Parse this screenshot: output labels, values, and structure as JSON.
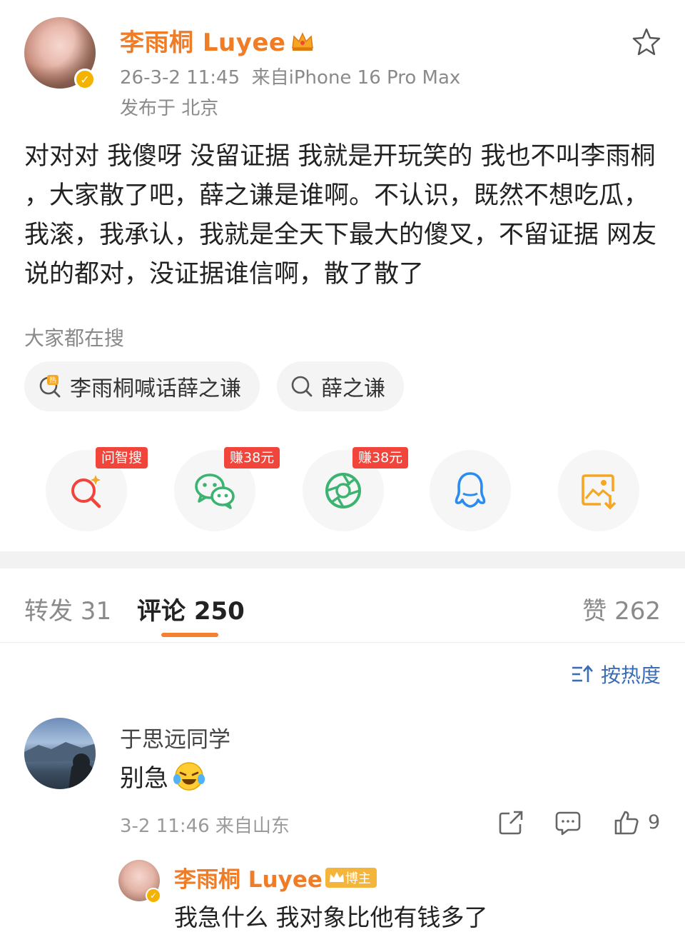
{
  "post": {
    "author": "李雨桐 Luyee",
    "timestamp": "26-3-2 11:45",
    "source": "来自iPhone 16 Pro Max",
    "location": "发布于 北京",
    "body": "对对对 我傻呀 没留证据 我就是开玩笑的 我也不叫李雨桐 ，大家散了吧，薛之谦是谁啊。不认识，既然不想吃瓜，我滚，我承认，我就是全天下最大的傻叉，不留证据 网友说的都对，没证据谁信啊，散了散了"
  },
  "search": {
    "label": "大家都在搜",
    "chips": [
      {
        "text": "李雨桐喊话薛之谦",
        "icon": "hot-search-icon"
      },
      {
        "text": "薛之谦",
        "icon": "search-icon"
      }
    ]
  },
  "share": {
    "items": [
      {
        "icon": "ai-search-icon",
        "badge": "问智搜",
        "color": "#f1443a"
      },
      {
        "icon": "wechat-icon",
        "badge": "赚38元",
        "color": "#3cb371"
      },
      {
        "icon": "moments-icon",
        "badge": "赚38元",
        "color": "#3cb371"
      },
      {
        "icon": "qq-icon",
        "badge": "",
        "color": "#2b8cf0"
      },
      {
        "icon": "save-image-icon",
        "badge": "",
        "color": "#f5a623"
      }
    ]
  },
  "tabs": {
    "repost": "转发 31",
    "comments": "评论 250",
    "likes": "赞 262"
  },
  "sort_label": "按热度",
  "comment": {
    "author": "于思远同学",
    "text": "别急",
    "meta": "3-2 11:46 来自山东",
    "likes": "9"
  },
  "reply": {
    "author": "李雨桐 Luyee",
    "badge": "博主",
    "text": "我急什么 我对象比他有钱多了"
  },
  "colors": {
    "accent": "#f07c26",
    "link": "#3a6db5",
    "badge_red": "#f1443a"
  }
}
